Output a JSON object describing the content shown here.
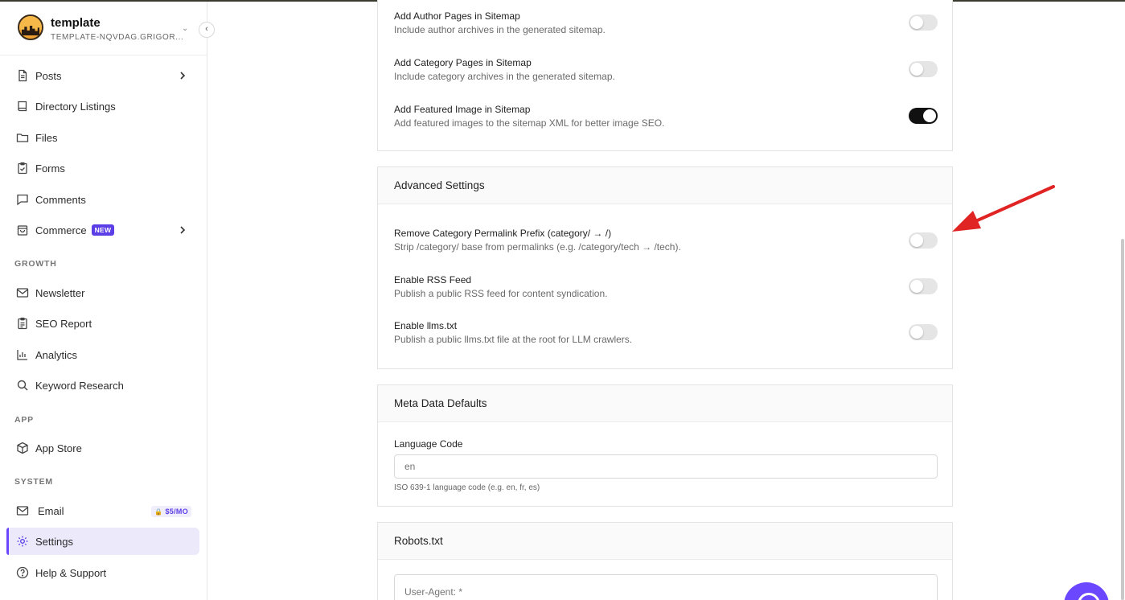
{
  "site": {
    "name": "template",
    "subtitle": "TEMPLATE-NQVDAG.GRIGOR..."
  },
  "sidebar": {
    "items": [
      {
        "label": "Posts",
        "icon": "document-icon"
      },
      {
        "label": "Directory Listings",
        "icon": "book-icon"
      },
      {
        "label": "Files",
        "icon": "folder-icon"
      },
      {
        "label": "Forms",
        "icon": "clipboard-icon"
      },
      {
        "label": "Comments",
        "icon": "comment-icon"
      },
      {
        "label": "Commerce",
        "icon": "shopping-bag-icon",
        "badge": "NEW"
      }
    ],
    "growth_label": "GROWTH",
    "growth": [
      {
        "label": "Newsletter",
        "icon": "mail-icon"
      },
      {
        "label": "SEO Report",
        "icon": "clipboard-list-icon"
      },
      {
        "label": "Analytics",
        "icon": "bar-chart-icon"
      },
      {
        "label": "Keyword Research",
        "icon": "search-icon"
      }
    ],
    "app_label": "APP",
    "app": [
      {
        "label": "App Store",
        "icon": "box-icon"
      }
    ],
    "system_label": "SYSTEM",
    "system": [
      {
        "label": "Email",
        "icon": "mail-icon",
        "badge": "$5/MO"
      },
      {
        "label": "Settings",
        "icon": "gear-icon",
        "active": true
      },
      {
        "label": "Help & Support",
        "icon": "help-circle-icon"
      }
    ]
  },
  "sitemap": {
    "author": {
      "title": "Add Author Pages in Sitemap",
      "desc": "Include author archives in the generated sitemap.",
      "enabled": false
    },
    "category": {
      "title": "Add Category Pages in Sitemap",
      "desc": "Include category archives in the generated sitemap.",
      "enabled": false
    },
    "featured": {
      "title": "Add Featured Image in Sitemap",
      "desc": "Add featured images to the sitemap XML for better image SEO.",
      "enabled": true
    }
  },
  "advanced": {
    "title": "Advanced Settings",
    "remove_prefix": {
      "title": "Remove Category Permalink Prefix (category/ → /)",
      "desc": "Strip /category/ base from permalinks (e.g. /category/tech → /tech).",
      "enabled": false
    },
    "rss": {
      "title": "Enable RSS Feed",
      "desc": "Publish a public RSS feed for content syndication.",
      "enabled": false
    },
    "llms": {
      "title": "Enable llms.txt",
      "desc": "Publish a public llms.txt file at the root for LLM crawlers.",
      "enabled": false
    }
  },
  "meta": {
    "title": "Meta Data Defaults",
    "language_label": "Language Code",
    "language_placeholder": "en",
    "language_help": "ISO 639-1 language code (e.g. en, fr, es)"
  },
  "robots": {
    "title": "Robots.txt",
    "placeholder": "User-Agent: *"
  },
  "colors": {
    "accent": "#6b47ff",
    "annotation_arrow": "#e02424",
    "toggle_on": "#111111"
  }
}
